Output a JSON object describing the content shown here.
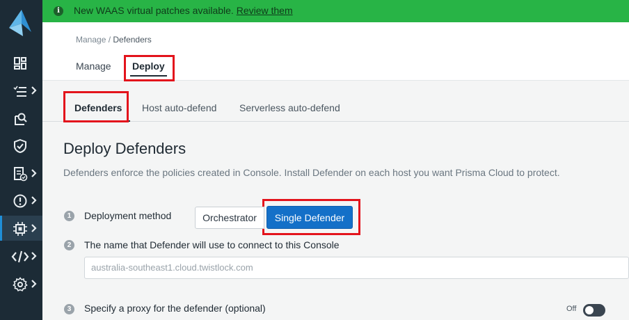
{
  "banner": {
    "message": "New WAAS virtual patches available.",
    "link": "Review them"
  },
  "breadcrumb": {
    "parent": "Manage",
    "separator": " / ",
    "current": "Defenders"
  },
  "top_tabs": [
    {
      "label": "Manage",
      "active": false
    },
    {
      "label": "Deploy",
      "active": true
    }
  ],
  "sub_tabs": [
    {
      "label": "Defenders",
      "active": true
    },
    {
      "label": "Host auto-defend",
      "active": false
    },
    {
      "label": "Serverless auto-defend",
      "active": false
    }
  ],
  "page": {
    "title": "Deploy Defenders",
    "description": "Defenders enforce the policies created in Console. Install Defender on each host you want Prisma Cloud to protect."
  },
  "steps": [
    {
      "number": "1",
      "label": "Deployment method"
    },
    {
      "number": "2",
      "label": "The name that Defender will use to connect to this Console"
    },
    {
      "number": "3",
      "label": "Specify a proxy for the defender (optional)"
    }
  ],
  "deployment_method": {
    "options": [
      "Orchestrator",
      "Single Defender"
    ],
    "selected": "Single Defender"
  },
  "console_name": {
    "value": "australia-southeast1.cloud.twistlock.com"
  },
  "proxy_toggle": {
    "label": "Off",
    "state": "off"
  },
  "sidebar_icons": [
    "logo-icon",
    "dashboard-icon",
    "monitor-list-icon",
    "radar-search-icon",
    "defend-shield-icon",
    "compliance-icon",
    "alerts-icon",
    "manage-chip-icon",
    "code-icon",
    "settings-gear-icon"
  ],
  "colors": {
    "banner": "#28b446",
    "sidebar": "#1c2b36",
    "primary_button": "#1470c8",
    "highlight": "#e3141c"
  }
}
